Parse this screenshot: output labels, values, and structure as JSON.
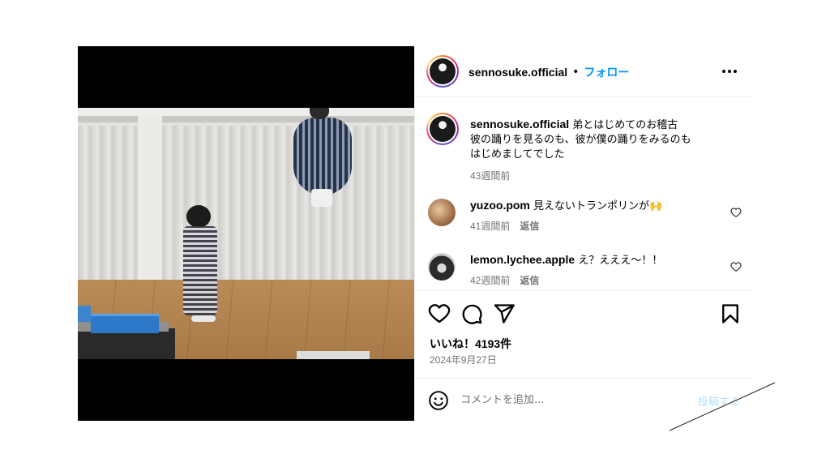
{
  "post": {
    "username": "sennosuke.official",
    "separator": "•",
    "follow_label": "フォロー",
    "more_icon": "more-horizontal-icon"
  },
  "caption": {
    "username": "sennosuke.official",
    "lines": [
      "弟とはじめてのお稽古",
      "彼の踊りを見るのも、彼が僕の踊りをみるのも",
      "はじめましてでした"
    ],
    "time": "43週間前"
  },
  "comments": [
    {
      "username": "yuzoo.pom",
      "text": "見えないトランポリンが🙌",
      "time": "41週間前",
      "reply_label": "返信"
    },
    {
      "username": "lemon.lychee.apple",
      "text": "え？えええ〜！！",
      "time": "42週間前",
      "reply_label": "返信"
    }
  ],
  "actions": {
    "like_icon": "heart-icon",
    "comment_icon": "comment-bubble-icon",
    "share_icon": "paper-plane-icon",
    "save_icon": "bookmark-icon",
    "likes_text": "いいね！4193件",
    "date": "2024年9月27日"
  },
  "composer": {
    "emoji_icon": "smiley-icon",
    "placeholder": "コメントを追加...",
    "post_label": "投稿する"
  },
  "colors": {
    "follow_blue": "#0095f6",
    "meta_gray": "#737373",
    "post_disabled": "#b2dffc",
    "divider": "#efefef"
  }
}
